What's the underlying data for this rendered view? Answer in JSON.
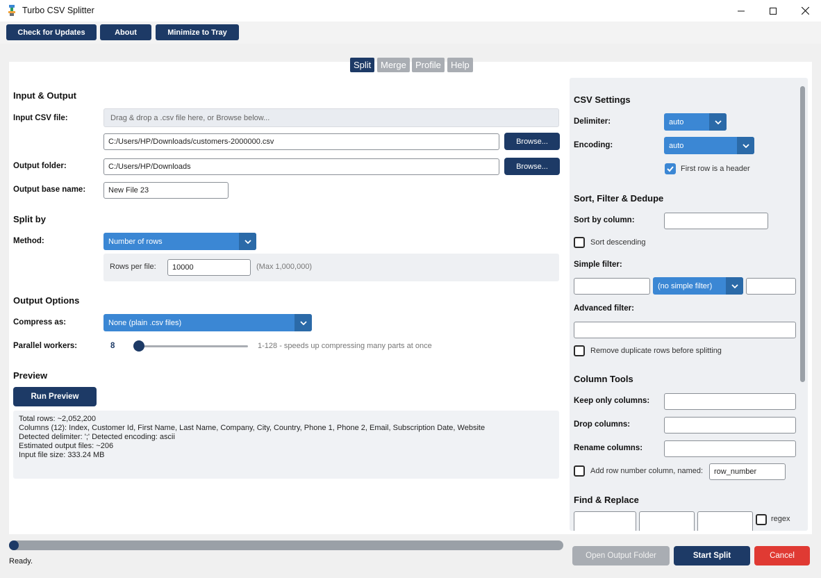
{
  "window": {
    "title": "Turbo CSV Splitter"
  },
  "toolbar": {
    "check_updates": "Check for Updates",
    "about": "About",
    "minimize_tray": "Minimize to Tray"
  },
  "tabs": [
    {
      "label": "Split",
      "active": true
    },
    {
      "label": "Merge",
      "active": false
    },
    {
      "label": "Profile",
      "active": false
    },
    {
      "label": "Help",
      "active": false
    }
  ],
  "input_output": {
    "title": "Input & Output",
    "input_label": "Input CSV file:",
    "dropzone": "Drag & drop a .csv file here, or Browse below...",
    "input_path": "C:/Users/HP/Downloads/customers-2000000.csv",
    "browse": "Browse...",
    "output_label": "Output folder:",
    "output_path": "C:/Users/HP/Downloads",
    "basename_label": "Output base name:",
    "basename": "New File 23"
  },
  "split_by": {
    "title": "Split by",
    "method_label": "Method:",
    "method": "Number of rows",
    "rows_label": "Rows per file:",
    "rows": "10000",
    "rows_hint": "(Max 1,000,000)"
  },
  "output_options": {
    "title": "Output Options",
    "compress_label": "Compress as:",
    "compress": "None (plain .csv files)",
    "workers_label": "Parallel workers:",
    "workers": "8",
    "workers_hint": "1-128 - speeds up compressing many parts at once"
  },
  "preview": {
    "title": "Preview",
    "run": "Run Preview",
    "lines": [
      "Total rows: ~2,052,200",
      "Columns (12): Index, Customer Id, First Name, Last Name, Company, City, Country, Phone 1, Phone 2, Email, Subscription Date, Website",
      "Detected delimiter: ';'    Detected encoding: ascii",
      "Estimated output files: ~206",
      "Input file size: 333.24 MB"
    ]
  },
  "csv_settings": {
    "title": "CSV Settings",
    "delimiter_label": "Delimiter:",
    "delimiter": "auto",
    "encoding_label": "Encoding:",
    "encoding": "auto",
    "header_label": "First row is a header"
  },
  "sort_filter": {
    "title": "Sort, Filter & Dedupe",
    "sort_label": "Sort by column:",
    "sort_desc": "Sort descending",
    "simple_label": "Simple filter:",
    "simple_op": "(no simple filter)",
    "advanced_label": "Advanced filter:",
    "dedupe": "Remove duplicate rows before splitting"
  },
  "column_tools": {
    "title": "Column Tools",
    "keep_label": "Keep only columns:",
    "drop_label": "Drop columns:",
    "rename_label": "Rename columns:",
    "rownum_label": "Add row number column, named:",
    "rownum_value": "row_number"
  },
  "find_replace": {
    "title": "Find & Replace",
    "regex": "regex"
  },
  "status": {
    "text": "Ready."
  },
  "actions": {
    "open_folder": "Open Output Folder",
    "start": "Start Split",
    "cancel": "Cancel"
  },
  "colors": {
    "primary": "#1d3a66",
    "accent": "#3b87d4",
    "cancel": "#e03a33"
  }
}
